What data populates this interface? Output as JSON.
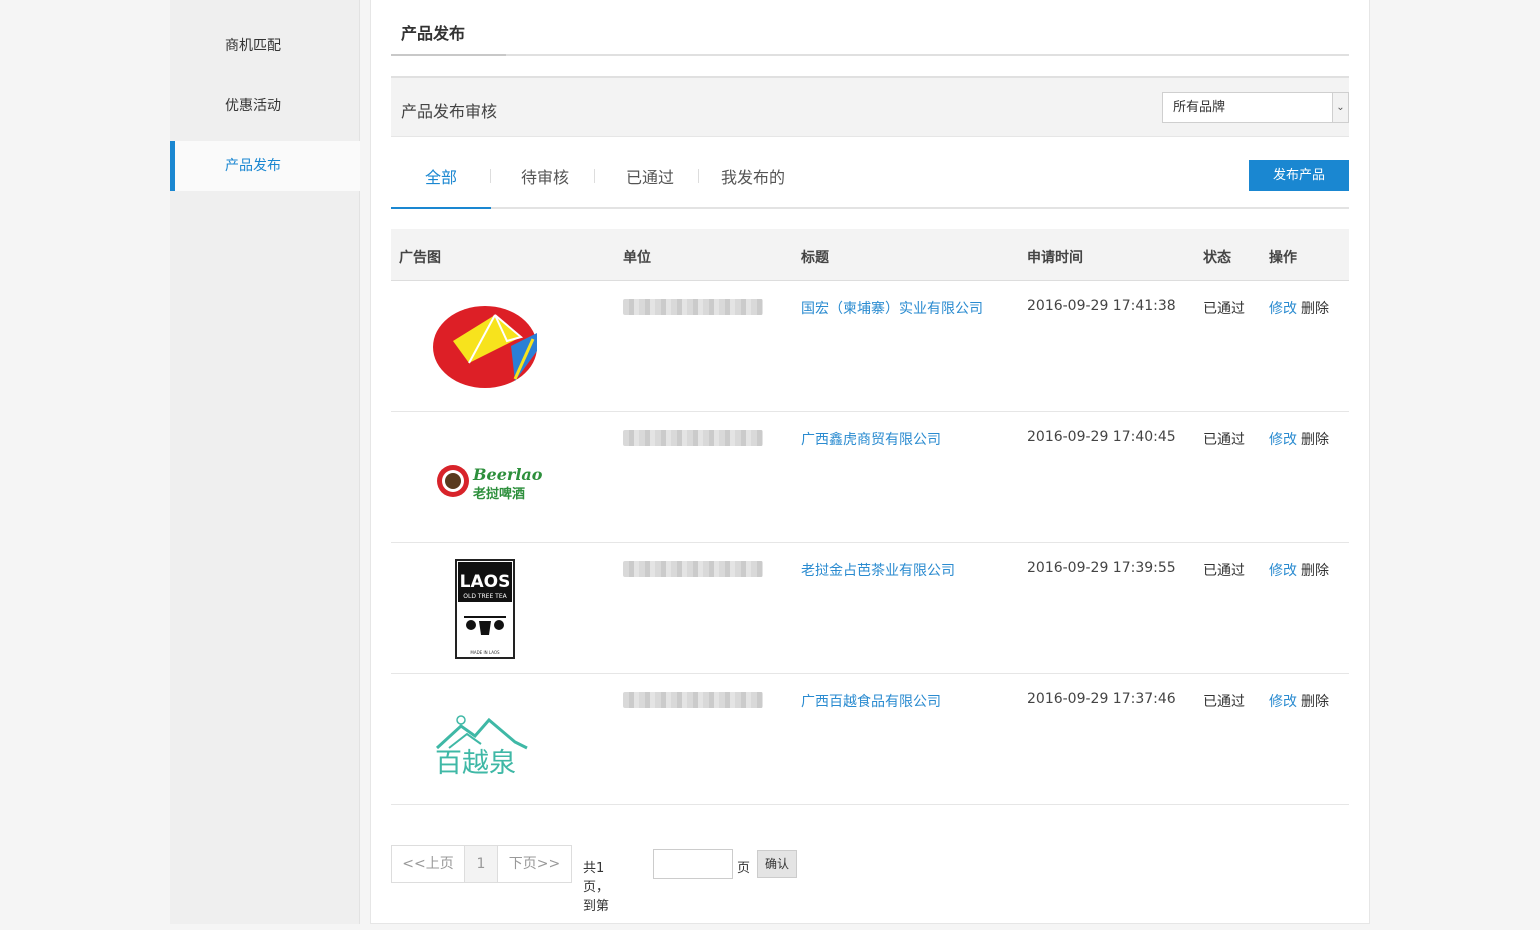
{
  "sidebar": {
    "items": [
      {
        "label": "商机匹配"
      },
      {
        "label": "优惠活动"
      },
      {
        "label": "产品发布"
      }
    ]
  },
  "header": {
    "title": "产品发布"
  },
  "filter": {
    "title": "产品发布审核",
    "brand_select_value": "所有品牌"
  },
  "tabs": [
    {
      "label": "全部"
    },
    {
      "label": "待审核"
    },
    {
      "label": "已通过"
    },
    {
      "label": "我发布的"
    }
  ],
  "publish_button": "发布产品",
  "table": {
    "columns": [
      "广告图",
      "单位",
      "标题",
      "申请时间",
      "状态",
      "操作"
    ],
    "rows": [
      {
        "logo": "red-yellow-kite-logo",
        "title": "国宏（柬埔寨）实业有限公司",
        "time": "2016-09-29 17:41:38",
        "status": "已通过",
        "edit": "修改",
        "delete": "删除"
      },
      {
        "logo": "beerlao-logo",
        "logo_text_en": "Beerlao",
        "logo_text_cn": "老挝啤酒",
        "title": "广西鑫虎商贸有限公司",
        "time": "2016-09-29 17:40:45",
        "status": "已通过",
        "edit": "修改",
        "delete": "删除"
      },
      {
        "logo": "laos-old-tree-tea-logo",
        "logo_text_main": "LAOS",
        "logo_text_sub": "OLD TREE TEA",
        "logo_text_foot": "MADE IN LAOS",
        "title": "老挝金占芭茶业有限公司",
        "time": "2016-09-29 17:39:55",
        "status": "已通过",
        "edit": "修改",
        "delete": "删除"
      },
      {
        "logo": "baiyue-logo",
        "logo_text": "百越",
        "logo_text_2": "泉",
        "title": "广西百越食品有限公司",
        "time": "2016-09-29 17:37:46",
        "status": "已通过",
        "edit": "修改",
        "delete": "删除"
      }
    ]
  },
  "pagination": {
    "prev": "<<上页",
    "current": "1",
    "next": "下页>>",
    "total_text": "共1页，到第",
    "page_suffix": "页",
    "confirm": "确认"
  },
  "colors": {
    "accent": "#1a87d1",
    "link": "#2a8bd0"
  }
}
